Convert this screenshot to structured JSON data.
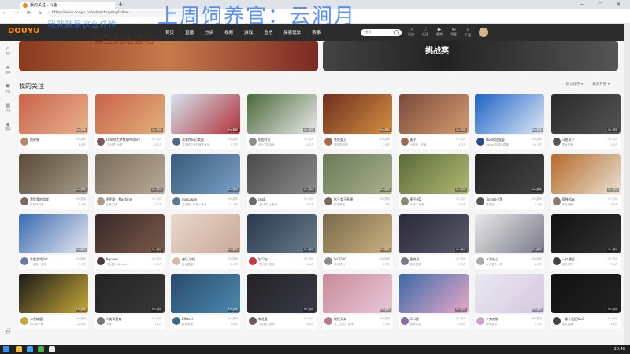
{
  "browser": {
    "tab_title": "我的关注 - 斗鱼",
    "url": "https://www.douyu.com/directory/myFollow",
    "nav_glyphs": "← → ⟳ ⌂",
    "window_controls": "— ▢ ✕",
    "new_tab": "+"
  },
  "overlay": {
    "title": "上周饲养官：云涧月",
    "sub1": "我就就是这么任性",
    "sub2": "官宣的组竖功"
  },
  "site": {
    "logo": "DOUYU",
    "nav": [
      "首页",
      "直播",
      "分类",
      "视频",
      "游戏",
      "鱼吧",
      "探索玩法",
      "赛事"
    ],
    "search_placeholder": "搜索",
    "icons": [
      {
        "name": "history",
        "label": "历史",
        "glyph": "◷"
      },
      {
        "name": "follow",
        "label": "关注",
        "glyph": "♡"
      },
      {
        "name": "video",
        "label": "视频",
        "glyph": "▶"
      },
      {
        "name": "message",
        "label": "消息",
        "glyph": "✉"
      },
      {
        "name": "download",
        "label": "下载",
        "glyph": "⤓"
      },
      {
        "name": "live",
        "label": "开播",
        "glyph": "◉"
      }
    ]
  },
  "sidebar": [
    {
      "label": "首页",
      "glyph": "⌂"
    },
    {
      "label": "推荐",
      "glyph": "★"
    },
    {
      "label": "关注",
      "glyph": "♥"
    },
    {
      "label": "分类",
      "glyph": "▦"
    },
    {
      "label": "赛事",
      "glyph": "◆"
    },
    {
      "label": "更多",
      "glyph": "…"
    }
  ],
  "page": {
    "banner_text": "挑战赛",
    "section_title": "我的关注",
    "sort1": "默认排序 ▾",
    "sort2": "最新开播 ▾"
  },
  "cards": [
    {
      "name": "怡果果",
      "title": "",
      "tag": "Mr.游戏",
      "views": "6.8万",
      "c1": "#c9624a",
      "c2": "#e8b28d",
      "a": "#b58a6a"
    },
    {
      "name": "10000大梦想家Mistery",
      "title": "【沙漠】大胆",
      "tag": "Mr.游戏",
      "views": "10.2万",
      "c1": "#c9624a",
      "c2": "#e3b07a",
      "a": "#7a5a5a"
    },
    {
      "name": "未来特码小卖部",
      "title": "【永恒之塔】魅族大战",
      "tag": "Mr.游戏",
      "views": "5.7万",
      "c1": "#d3e4ef",
      "c2": "#b3303a",
      "a": "#4f6a84"
    },
    {
      "name": "东西时光",
      "title": "卢先生的游戏",
      "tag": "Mr.游戏",
      "views": "2.1万",
      "c1": "#4a6a3a",
      "c2": "#e9e9e9",
      "a": "#8c8c8c"
    },
    {
      "name": "苍然女王",
      "title": "周年游戏赛",
      "tag": "Mr.游戏",
      "views": "3.6万",
      "c1": "#6f2f20",
      "c2": "#d38f42",
      "a": "#a66b4a"
    },
    {
      "name": "麦子",
      "title": "小游戏 - 开局",
      "tag": "Mr.游戏",
      "views": "1.3万",
      "c1": "#7a4a3a",
      "c2": "#d59a70",
      "a": "#9a6a5a"
    },
    {
      "name": "Doinb加强版",
      "title": "Doinb 加强版直播",
      "tag": "Mr.游戏",
      "views": "54.3万",
      "c1": "#1e63c8",
      "c2": "#dfe8f5",
      "a": "#2a4a8a"
    },
    {
      "name": "斗鱼虎子",
      "title": "游戏日常",
      "tag": "Mr.游戏",
      "views": "1.9万",
      "c1": "#2a2a2a",
      "c2": "#555555",
      "a": "#555"
    },
    {
      "name": "我是我的游戏",
      "title": "打游戏日常",
      "tag": "Mr.游戏",
      "views": "8.4万",
      "c1": "#5a4a3a",
      "c2": "#a59a88",
      "a": "#7a6a5a"
    },
    {
      "name": "明明哥 - Machine",
      "title": "瓦洛兰特",
      "tag": "Mr.游戏",
      "views": "2.2万",
      "c1": "#7a6a5a",
      "c2": "#b8aa99",
      "a": "#b09a88"
    },
    {
      "name": "mosuwan",
      "title": "【大神】开局一条龙",
      "tag": "Mr.游戏",
      "views": "17.3万",
      "c1": "#3a5a7a",
      "c2": "#7aa0c8",
      "a": "#5a7a9a"
    },
    {
      "name": "zxg8",
      "title": "【大神】三角洲",
      "tag": "Mr.游戏",
      "views": "3.2万",
      "c1": "#4a4a4a",
      "c2": "#8a8a8a",
      "a": "#6a6a6a"
    },
    {
      "name": "影子女王直播",
      "title": "和平精英",
      "tag": "Mr.游戏",
      "views": "3.5万",
      "c1": "#6a7a5a",
      "c2": "#a8b08a",
      "a": "#7a6a5a"
    },
    {
      "name": "麦子HD",
      "title": "PUBG 日常",
      "tag": "Mr.游戏",
      "views": "2.9万",
      "c1": "#5a6a3a",
      "c2": "#b0b870",
      "a": "#8a8a6a"
    },
    {
      "name": "Tony的小黑",
      "title": "黑神话",
      "tag": "Mr.游戏",
      "views": "1.2万",
      "c1": "#222",
      "c2": "#444",
      "a": "#555"
    },
    {
      "name": "孤独Max",
      "title": "代码编程",
      "tag": "Mr.游戏",
      "views": "0.9万",
      "c1": "#b56a2a",
      "c2": "#e9e0d0",
      "a": "#8a7a6a"
    },
    {
      "name": "东雷游戏Bot",
      "title": "【经典】游戏",
      "tag": "Mr.游戏",
      "views": "3.1万",
      "c1": "#3a6ab0",
      "c2": "#e8e8f0",
      "a": "#6a7ab0"
    },
    {
      "name": "Nguyen",
      "title": "【其他】Nguyen",
      "tag": "Mr.游戏",
      "views": "2.0万",
      "c1": "#3a2a2a",
      "c2": "#7a5a4a",
      "a": "#4a3a3a"
    },
    {
      "name": "越乐儿呀",
      "title": "美女直播",
      "tag": "Mr.游戏",
      "views": "8.0万",
      "c1": "#e8d8cc",
      "c2": "#c8a898",
      "a": "#d8b8a8"
    },
    {
      "name": "fyc2@",
      "title": "【大神】团战",
      "tag": "Mr.游戏",
      "views": "4.4万",
      "c1": "#2a3a4a",
      "c2": "#6a7a8a",
      "a": "#c23a3a"
    },
    {
      "name": "SoTOAG",
      "title": "战地风云",
      "tag": "Mr.游戏",
      "views": "2.7万",
      "c1": "#7a6a4a",
      "c2": "#c8b080",
      "a": "#8a8a8a"
    },
    {
      "name": "麦克风",
      "title": "游戏日常",
      "tag": "Mr.游戏",
      "views": "1.5万",
      "c1": "#2a2a3a",
      "c2": "#5a5a6a",
      "a": "#7a7a8a"
    },
    {
      "name": "水泥封心",
      "title": "六六爱吃小羊",
      "tag": "Mr.游戏",
      "views": "2.3万",
      "c1": "#e8e8e8",
      "c2": "#7a7a8a",
      "a": "#aaa"
    },
    {
      "name": "一口橘园",
      "title": "深夜恐怖",
      "tag": "Mr.游戏",
      "views": "1.0万",
      "c1": "#111",
      "c2": "#333",
      "a": "#444"
    },
    {
      "name": "斗鱼联盟",
      "title": "S12世一猜",
      "tag": "Mr.游戏",
      "views": "12.6万",
      "c1": "#1a1a1a",
      "c2": "#c8a838",
      "a": "#c8a838"
    },
    {
      "name": "少女高智商",
      "title": "开局",
      "tag": "Mr.游戏",
      "views": "1.1万",
      "c1": "#222",
      "c2": "#3a3a3a",
      "a": "#777"
    },
    {
      "name": "EXBoLl",
      "title": "英雄联盟",
      "tag": "Mr.游戏",
      "views": "4.8万",
      "c1": "#2a4a6a",
      "c2": "#4a8ab0",
      "a": "#3a6a8a"
    },
    {
      "name": "李逍遥",
      "title": "【经典】游戏",
      "tag": "Mr.游戏",
      "views": "3.0万",
      "c1": "#222",
      "c2": "#3a3a4a",
      "a": "#6a5a5a"
    },
    {
      "name": "教授又来",
      "title": "【二次元】游戏",
      "tag": "Mr.游戏",
      "views": "2.5万",
      "c1": "#c88a9a",
      "c2": "#e8c8d8",
      "a": "#b87a8a"
    },
    {
      "name": "Sini酱",
      "title": "游戏实况",
      "tag": "Mr.游戏",
      "views": "2.0万",
      "c1": "#3a6aa8",
      "c2": "#e8a8c8",
      "a": "#8a6aa8"
    },
    {
      "name": "小鬼吃饭",
      "title": "聊天互动",
      "tag": "Mr.游戏",
      "views": "1.7万",
      "c1": "#e8e8f0",
      "c2": "#d8c8e0",
      "a": "#c8a8c8"
    },
    {
      "name": "一条小团团OvO",
      "title": "周末直播",
      "tag": "Mr.游戏",
      "views": "11.0万",
      "c1": "#111",
      "c2": "#222",
      "a": "#444"
    }
  ],
  "taskbar": {
    "time": "20:48"
  }
}
